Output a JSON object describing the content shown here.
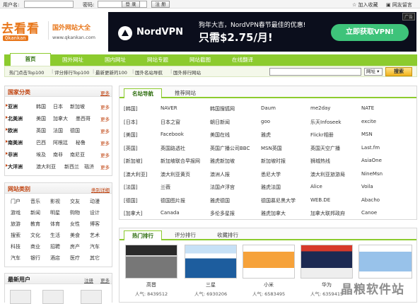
{
  "topbar": {
    "username_label": "用户名:",
    "password_label": "密码:",
    "login_btn": "登 录",
    "register_btn": "注 册",
    "bookmark": "加入收藏",
    "guestbook": "网友留言"
  },
  "logo": {
    "cn": "去看看",
    "en": "Qkankan",
    "slogan": "国外网站大全",
    "url": "www.qkankan.com"
  },
  "banner": {
    "ad_badge": "广告",
    "brand": "NordVPN",
    "line1": "狗年大吉，NordVPN春节最佳的优惠!",
    "line2": "只需$2.75/月!",
    "cta": "立即获取VPN!"
  },
  "nav": {
    "tabs": [
      "首页",
      "国外网址",
      "国内网址",
      "网站专题",
      "网站截图",
      "在线翻译"
    ]
  },
  "subnav": {
    "links": [
      "热门点击Top100",
      "评分排行Top100",
      "最新更新的100",
      "国外名站导航",
      "国外排行网站"
    ],
    "search_placeholder": "",
    "search_scope": "网址",
    "search_btn": "搜索"
  },
  "regions": {
    "title": "国家分类",
    "more": "更多",
    "rows": [
      {
        "name": "亚洲",
        "countries": [
          "韩国",
          "日本",
          "新加坡"
        ],
        "more": "更多"
      },
      {
        "name": "北美洲",
        "countries": [
          "美国",
          "加拿大",
          "墨西哥"
        ],
        "more": "更多"
      },
      {
        "name": "欧洲",
        "countries": [
          "英国",
          "法国",
          "德国"
        ],
        "more": "更多"
      },
      {
        "name": "南美洲",
        "countries": [
          "巴西",
          "阿根廷",
          "秘鲁"
        ],
        "more": "更多"
      },
      {
        "name": "非洲",
        "countries": [
          "埃及",
          "南非",
          "南尼亚"
        ],
        "more": "更多"
      },
      {
        "name": "大洋洲",
        "countries": [
          "澳大利亚",
          "新西兰",
          "瑙济"
        ],
        "more": "更多"
      }
    ]
  },
  "categories": {
    "title": "网站类别",
    "more": "类别详细",
    "rows": [
      [
        "门户",
        "音乐",
        "影视",
        "交友",
        "动漫"
      ],
      [
        "游戏",
        "新闻",
        "明星",
        "购物",
        "设计"
      ],
      [
        "旅游",
        "教育",
        "体育",
        "女性",
        "博客"
      ],
      [
        "搜索",
        "文化",
        "生活",
        "美食",
        "艺术"
      ],
      [
        "科技",
        "商业",
        "招聘",
        "房产",
        "汽车"
      ],
      [
        "汽车",
        "银行",
        "酒店",
        "医疗",
        "其它"
      ]
    ]
  },
  "newusers": {
    "title": "最新用户",
    "register": "注册",
    "more": "更多"
  },
  "main": {
    "tabs": [
      "名站导航",
      "推荐网站"
    ],
    "rows": [
      {
        "country": "[韩国]",
        "sites": [
          "NAVER",
          "韩国搜狐网",
          "Daum",
          "me2day",
          "NATE"
        ]
      },
      {
        "country": "[日本]",
        "sites": [
          "日本之窗",
          "朝日新闻",
          "goo",
          "乐天Infoseek",
          "excite"
        ]
      },
      {
        "country": "[美国]",
        "sites": [
          "Facebook",
          "美国在线",
          "雅虎",
          "Flickr相册",
          "MSN"
        ]
      },
      {
        "country": "[英国]",
        "sites": [
          "英国路透社",
          "英国广播公司BBC",
          "MSN英国",
          "英国天空广播",
          "Last.fm"
        ]
      },
      {
        "country": "[新加坡]",
        "sites": [
          "新加坡联合早报网",
          "雅虎新加坡",
          "新加坡时报",
          "狮城热线",
          "AsiaOne"
        ]
      },
      {
        "country": "[澳大利亚]",
        "sites": [
          "澳大利亚黄页",
          "澳洲人报",
          "悉尼大学",
          "澳大利亚旅游局",
          "NineMsn"
        ]
      },
      {
        "country": "[法国]",
        "sites": [
          "兰薇",
          "法国卢浮宫",
          "雅虎法国",
          "Alice",
          "Voila"
        ]
      },
      {
        "country": "[德国]",
        "sites": [
          "德国图片报",
          "雅虎德国",
          "德国慕尼黑大学",
          "WEB.DE",
          "Abacho"
        ]
      },
      {
        "country": "[加拿大]",
        "sites": [
          "Canada",
          "多伦多星报",
          "雅虎加拿大",
          "加拿大联邦政府",
          "Canoe"
        ]
      }
    ]
  },
  "hot": {
    "tabs": [
      "热门排行",
      "评分排行",
      "收藏排行"
    ],
    "items": [
      {
        "name": "高晋",
        "pop": "人气: 8439512"
      },
      {
        "name": "三星",
        "pop": "人气: 6930206"
      },
      {
        "name": "小米",
        "pop": "人气: 6583495"
      },
      {
        "name": "华为",
        "pop": "人气: 6359415"
      },
      {
        "name": "",
        "pop": ""
      }
    ]
  },
  "watermark": "晶粮软件站",
  "colors": {
    "accent": "#8ccb2e",
    "brand": "#e8761a",
    "link": "#c0420e"
  }
}
